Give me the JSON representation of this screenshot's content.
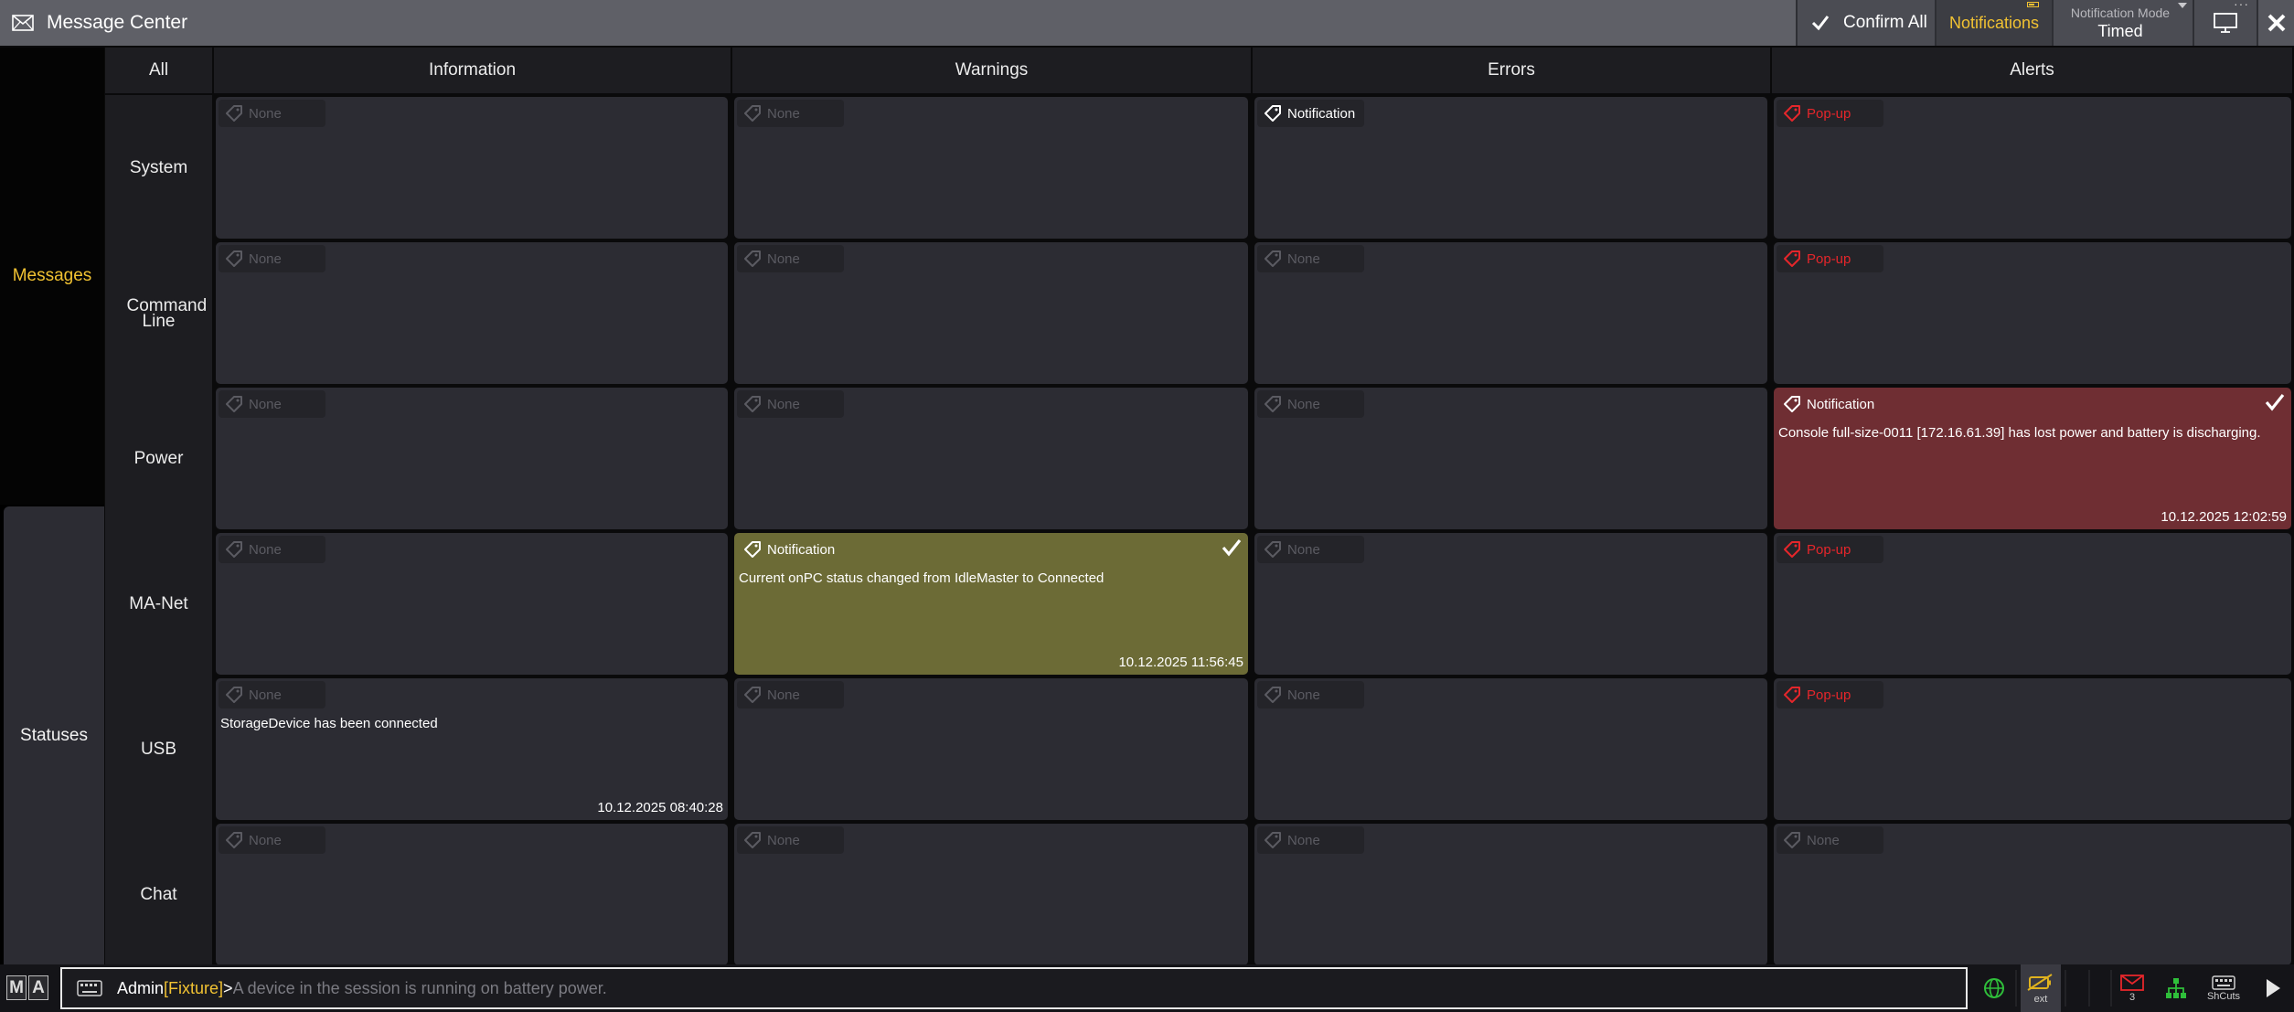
{
  "window": {
    "title": "Message Center",
    "title_icon": "envelope-icon"
  },
  "toolbar": {
    "confirm_all_label": "Confirm All",
    "notifications_label": "Notifications",
    "notification_mode_label": "Notification Mode",
    "notification_mode_value": "Timed"
  },
  "nav": {
    "messages_label": "Messages",
    "statuses_label": "Statuses"
  },
  "columns": [
    "All",
    "Information",
    "Warnings",
    "Errors",
    "Alerts"
  ],
  "rows": [
    {
      "label": "System",
      "cells": [
        {
          "tag": "None"
        },
        {
          "tag": "None"
        },
        {
          "tag": "Notification"
        },
        {
          "tag": "Pop-up"
        }
      ]
    },
    {
      "label": "Command Line",
      "cells": [
        {
          "tag": "None"
        },
        {
          "tag": "None"
        },
        {
          "tag": "None"
        },
        {
          "tag": "Pop-up"
        }
      ]
    },
    {
      "label": "Power",
      "cells": [
        {
          "tag": "None"
        },
        {
          "tag": "None"
        },
        {
          "tag": "None"
        },
        {
          "tag": "Notification",
          "message": "Console full-size-0011 [172.16.61.39] has lost power and battery is discharging.",
          "timestamp": "10.12.2025 12:02:59"
        }
      ]
    },
    {
      "label": "MA-Net",
      "cells": [
        {
          "tag": "None"
        },
        {
          "tag": "Notification",
          "message": "Current onPC status changed from IdleMaster to Connected",
          "timestamp": "10.12.2025 11:56:45"
        },
        {
          "tag": "None"
        },
        {
          "tag": "Pop-up"
        }
      ]
    },
    {
      "label": "USB",
      "cells": [
        {
          "tag": "None",
          "message": "StorageDevice has been connected",
          "timestamp": "10.12.2025 08:40:28"
        },
        {
          "tag": "None"
        },
        {
          "tag": "None"
        },
        {
          "tag": "Pop-up"
        }
      ]
    },
    {
      "label": "Chat",
      "cells": [
        {
          "tag": "None"
        },
        {
          "tag": "None"
        },
        {
          "tag": "None"
        },
        {
          "tag": "None"
        }
      ]
    }
  ],
  "commandline": {
    "user": "Admin",
    "object": "[Fixture]",
    "prompt_char": ">",
    "placeholder": "A device in the session is running on battery power."
  },
  "statusbar": {
    "ext_label": "ext",
    "message_count": "3",
    "shortcuts_label": "ShCuts"
  },
  "colors": {
    "title_bar": "#5f6067",
    "accent_yellow": "#f1c232",
    "cell_bg": "#2c2c33",
    "warning_event": "#6c6b36",
    "alert_event": "#6f2e33",
    "popup_red": "#e5262b"
  }
}
